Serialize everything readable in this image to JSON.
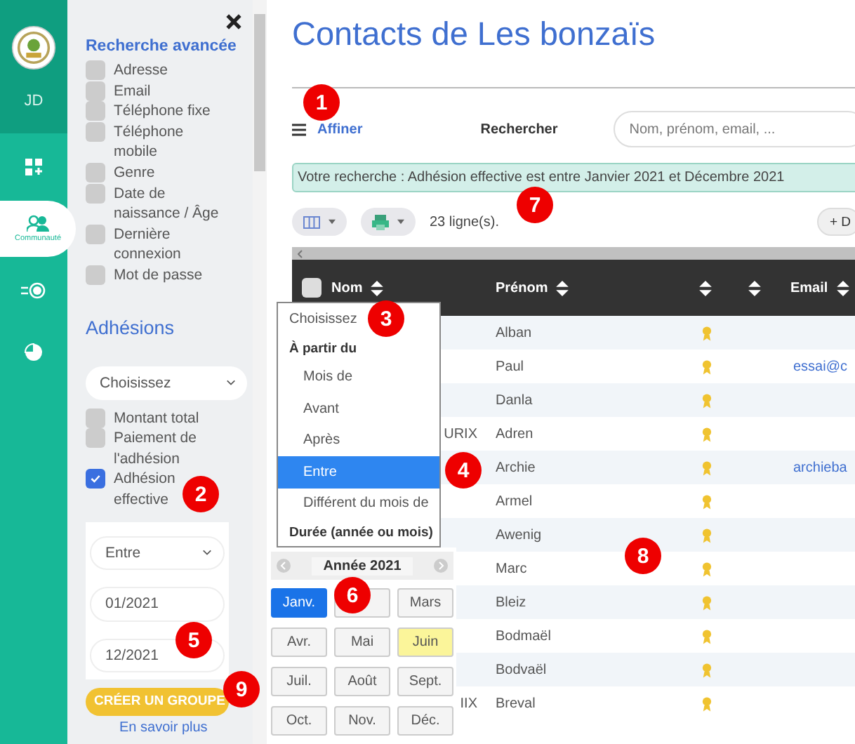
{
  "rail": {
    "user_initials": "JD",
    "items": [
      {
        "kind": "dashboard",
        "selected": false
      },
      {
        "kind": "community",
        "label": "Communauté",
        "selected": true
      },
      {
        "kind": "toggle",
        "selected": false
      },
      {
        "kind": "pie",
        "selected": false
      }
    ]
  },
  "panel": {
    "title": "Recherche avancée",
    "fields": [
      {
        "label": "Adresse",
        "checked": false
      },
      {
        "label": "Email",
        "checked": false
      },
      {
        "label": "Téléphone fixe",
        "checked": false
      },
      {
        "label": "Téléphone mobile",
        "checked": false
      },
      {
        "label": "Genre",
        "checked": false
      },
      {
        "label": "Date de naissance / Âge",
        "checked": false
      },
      {
        "label": "Dernière connexion",
        "checked": false
      },
      {
        "label": "Mot de passe",
        "checked": false
      }
    ],
    "section": "Adhésions",
    "section_select": "Choisissez",
    "membership_fields": [
      {
        "label": "Montant total",
        "checked": false
      },
      {
        "label": "Paiement de l'adhésion",
        "checked": false
      },
      {
        "label": "Adhésion effective",
        "checked": true
      }
    ],
    "condition": {
      "operator": "Entre",
      "from": "01/2021",
      "to": "12/2021"
    },
    "create_group_button": "CRÉER UN GROUPE",
    "learn_more": "En savoir plus"
  },
  "title": "Contacts de Les bonzaïs",
  "filter_link": "Affiner",
  "search_label": "Rechercher",
  "search": {
    "placeholder": "Nom, prénom, email, ..."
  },
  "search_summary": "Votre recherche : Adhésion effective est entre Janvier 2021 et Décembre 2021",
  "row_count": "23 ligne(s).",
  "add_button": "+ D",
  "table": {
    "all_selected": false,
    "columns": [
      "Nom",
      "Prénom",
      "Email"
    ],
    "rows": [
      {
        "first_name": "Alban",
        "member": true
      },
      {
        "first_name": "Paul",
        "member": true,
        "email": "essai@c"
      },
      {
        "first_name": "Danla",
        "member": true
      },
      {
        "name": "URIX",
        "first_name": "Adren",
        "member": true
      },
      {
        "first_name": "Archie",
        "member": true,
        "email": "archieba"
      },
      {
        "first_name": "Armel",
        "member": true
      },
      {
        "first_name": "Awenig",
        "member": true
      },
      {
        "first_name": "Marc",
        "member": true
      },
      {
        "first_name": "Bleiz",
        "member": true
      },
      {
        "first_name": "Bodmaël",
        "member": true
      },
      {
        "first_name": "Bodvaël",
        "member": true
      },
      {
        "name": "IIX",
        "first_name": "Breval",
        "member": true
      }
    ]
  },
  "operator_menu": [
    {
      "label": "Choisissez",
      "kind": "placeholder",
      "selected": false
    },
    {
      "label": "À partir du",
      "kind": "group",
      "selected": false
    },
    {
      "label": "Mois de",
      "kind": "option",
      "selected": false
    },
    {
      "label": "Avant",
      "kind": "option",
      "selected": false
    },
    {
      "label": "Après",
      "kind": "option",
      "selected": false
    },
    {
      "label": "Entre",
      "kind": "option",
      "selected": true
    },
    {
      "label": "Différent du mois de",
      "kind": "option",
      "selected": false
    },
    {
      "label": "Durée (année ou mois)",
      "kind": "group",
      "selected": false
    }
  ],
  "month_picker": {
    "year": "Année 2021",
    "months": [
      {
        "label": "Janv.",
        "selected": true,
        "current": false
      },
      {
        "selected": false,
        "current": false
      },
      {
        "label": "Mars",
        "selected": false,
        "current": false
      },
      {
        "label": "Avr.",
        "selected": false,
        "current": false
      },
      {
        "label": "Mai",
        "selected": false,
        "current": false
      },
      {
        "label": "Juin",
        "selected": false,
        "current": true
      },
      {
        "label": "Juil.",
        "selected": false,
        "current": false
      },
      {
        "label": "Août",
        "selected": false,
        "current": false
      },
      {
        "label": "Sept.",
        "selected": false,
        "current": false
      },
      {
        "label": "Oct.",
        "selected": false,
        "current": false
      },
      {
        "label": "Nov.",
        "selected": false,
        "current": false
      },
      {
        "label": "Déc.",
        "selected": false,
        "current": false
      }
    ]
  },
  "callouts": [
    "1",
    "2",
    "3",
    "4",
    "5",
    "6",
    "7",
    "8",
    "9"
  ]
}
